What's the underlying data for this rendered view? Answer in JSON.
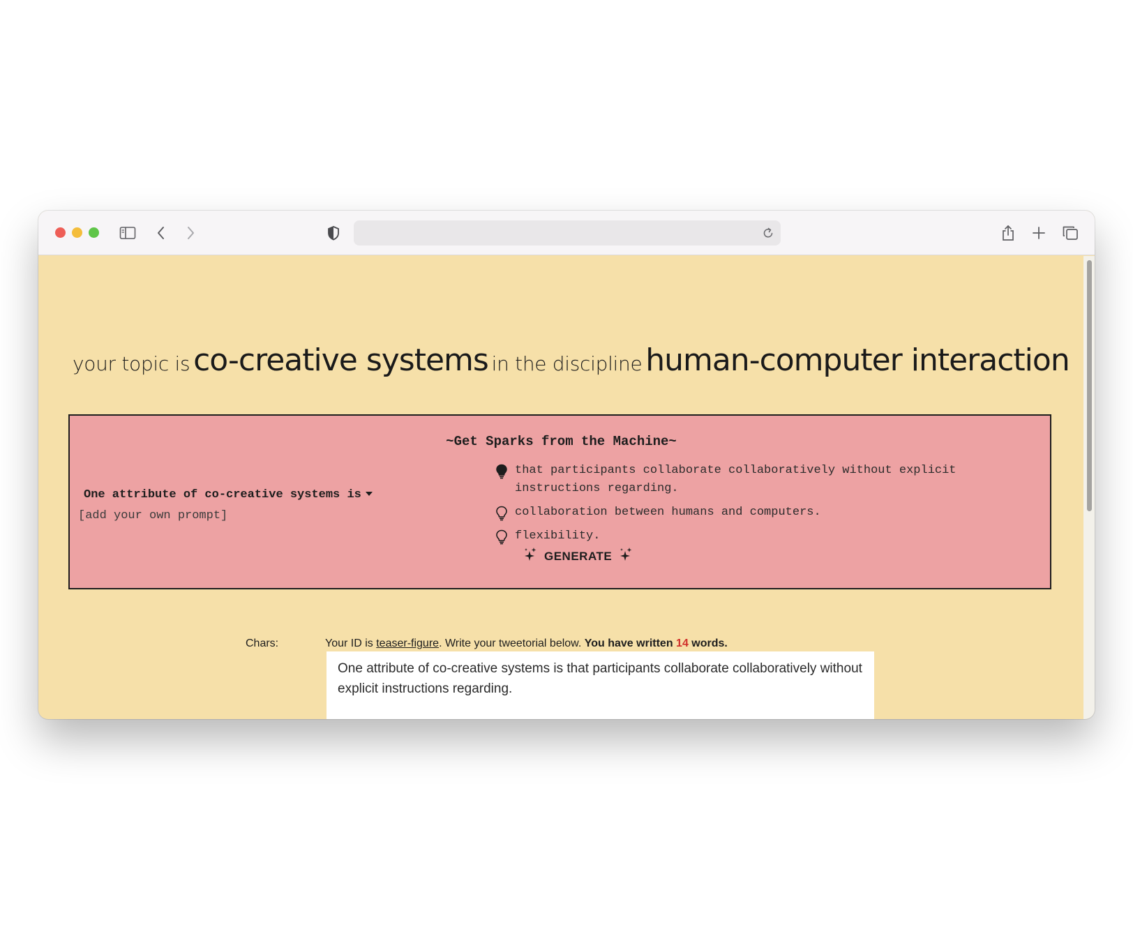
{
  "browser": {
    "toolbar_icons": [
      "sidebar-icon",
      "back-icon",
      "forward-icon",
      "shield-icon",
      "reload-icon",
      "share-icon",
      "new-tab-icon",
      "tabs-overview-icon"
    ]
  },
  "headline": {
    "prefix": "your topic is",
    "topic": "co-creative systems",
    "middle": "in the discipline",
    "discipline": "human-computer interaction"
  },
  "sparks": {
    "title": "~Get Sparks from the Machine~",
    "selected_prompt": "One attribute of co-creative systems is",
    "own_prompt_placeholder": "[add your own prompt]",
    "suggestions": [
      {
        "text": "that participants collaborate collaboratively without explicit instructions regarding.",
        "selected": true
      },
      {
        "text": "collaboration between humans and computers.",
        "selected": false
      },
      {
        "text": "flexibility.",
        "selected": false
      }
    ],
    "generate_label": "GENERATE"
  },
  "editor_area": {
    "chars_label": "Chars:",
    "id_prefix": "Your ID is",
    "user_id": "teaser-figure",
    "instruction": ". Write your tweetorial below.",
    "words_prefix": "You have written",
    "word_count": "14",
    "words_suffix": "words.",
    "text": "One attribute of co-creative systems is that participants collaborate collaboratively without explicit instructions regarding."
  },
  "colors": {
    "page_background": "#f6e0a9",
    "sparks_background": "#eda2a3",
    "word_count_color": "#d0302b"
  }
}
